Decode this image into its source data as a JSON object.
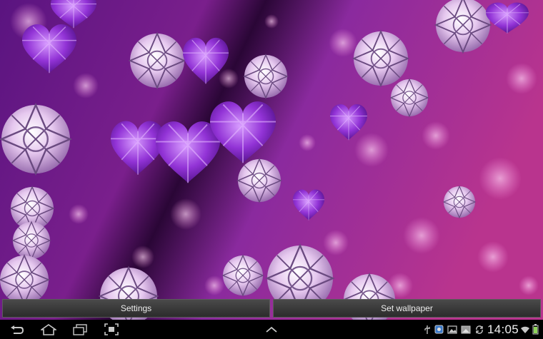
{
  "colors": {
    "bg_deep": "#4a0f6e",
    "bg_mid": "#8a2a9e",
    "bg_pink": "#c83b8f",
    "gem_light": "#e7c9ee",
    "gem_purple": "#8d2fd0",
    "button_text": "#ededed",
    "icon_gray": "#c8c8c8"
  },
  "actions": {
    "settings_label": "Settings",
    "set_wallpaper_label": "Set wallpaper"
  },
  "navbar": {
    "back_icon": "back-arrow-icon",
    "home_icon": "home-icon",
    "recents_icon": "recent-apps-icon",
    "screenshot_icon": "screenshot-icon",
    "menu_icon": "chevron-up-icon"
  },
  "status": {
    "icons": [
      "usb-icon",
      "notification-app-icon",
      "gallery-icon",
      "image-icon",
      "sync-icon"
    ],
    "time": "14:05",
    "wifi_icon": "wifi-icon",
    "battery_icon": "battery-icon"
  }
}
